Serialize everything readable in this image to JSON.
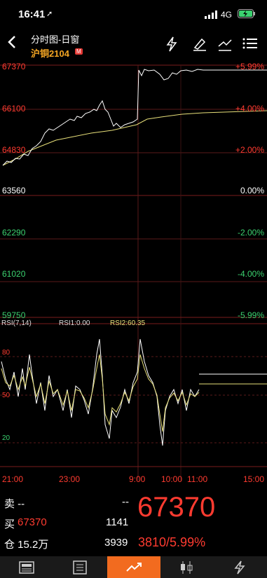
{
  "status": {
    "time": "16:41",
    "network": "4G"
  },
  "header": {
    "title": "分时图-日窗",
    "subtitle": "沪铜2104",
    "badge": "M"
  },
  "chart": {
    "price_ticks": [
      "67370",
      "66100",
      "64830",
      "63560",
      "62290",
      "61020",
      "59750"
    ],
    "pct_ticks": [
      "+5.99%",
      "+4.00%",
      "+2.00%",
      "0.00%",
      "-2.00%",
      "-4.00%",
      "-5.99%"
    ],
    "rsi_title": "RSI(7,14)",
    "rsi1": "RSI1:0.00",
    "rsi2": "RSI2:60.35",
    "rsi_ticks": [
      "80",
      "50",
      "20"
    ],
    "time_ticks": [
      "21:00",
      "23:00",
      "9:00",
      "10:00",
      "11:00",
      "15:00"
    ]
  },
  "quote": {
    "sell_label": "卖 --",
    "sell_vol": "--",
    "buy_label": "买",
    "buy_price": "67370",
    "buy_vol": "1141",
    "oi_label": "仓 15.2万",
    "volume": "3939",
    "last_price": "67370",
    "change": "3810/5.99%"
  },
  "colors": {
    "up": "#ff3b30",
    "down": "#3bd16f",
    "accent": "#f5a623",
    "price_line": "#ffffff",
    "avg_line": "#e8e07a"
  }
}
